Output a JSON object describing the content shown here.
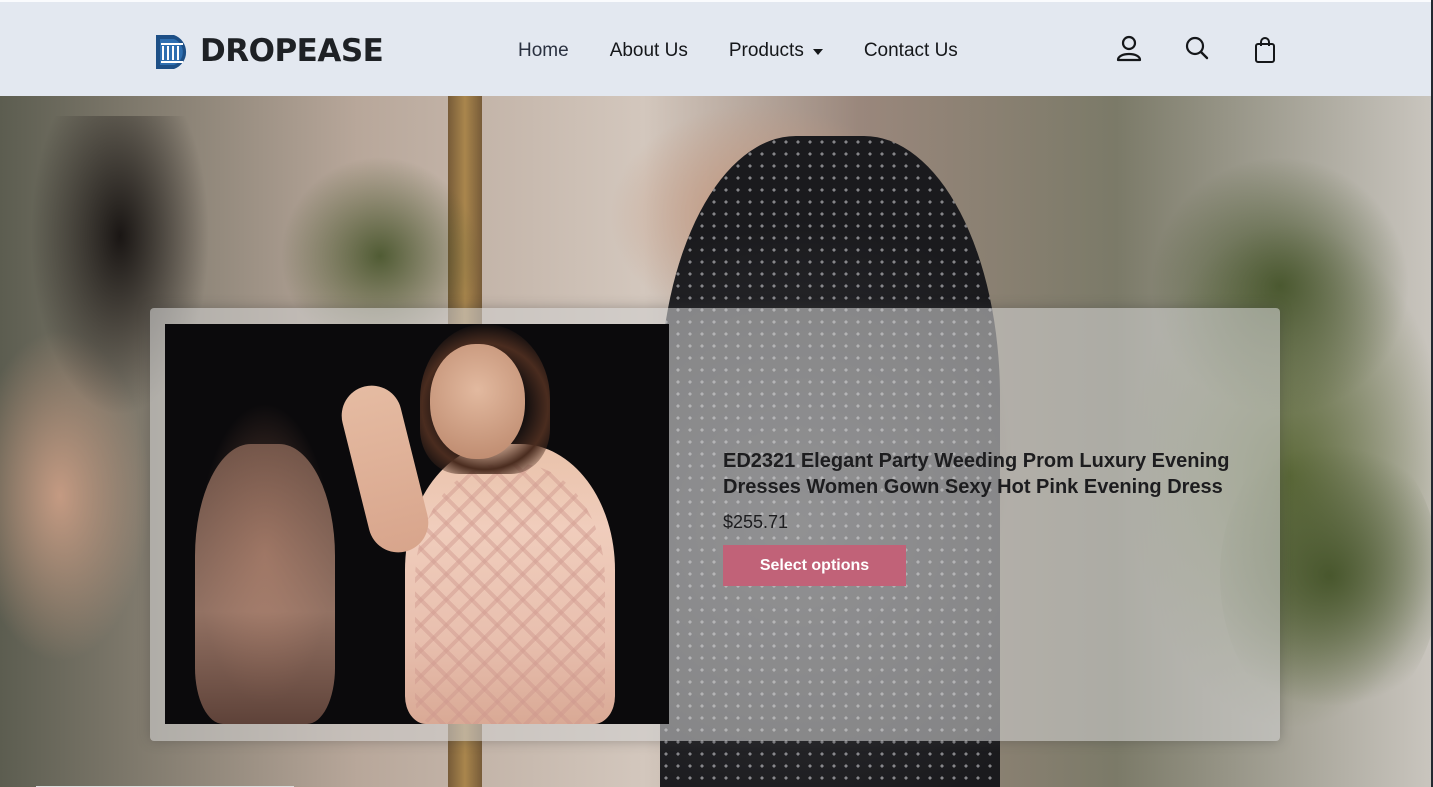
{
  "brand": {
    "name": "DROPEASE",
    "logo_icon": "bank-building-icon",
    "accent": "#1d4f86"
  },
  "nav": [
    {
      "label": "Home",
      "active": true
    },
    {
      "label": "About Us"
    },
    {
      "label": "Products",
      "has_dropdown": true
    },
    {
      "label": "Contact Us"
    }
  ],
  "header_icons": [
    "user-icon",
    "search-icon",
    "shopping-bag-icon"
  ],
  "product": {
    "title": "ED2321 Elegant Party Weeding Prom Luxury Evening Dresses Women Gown Sexy Hot Pink Evening Dress",
    "price": "$255.71",
    "button_label": "Select options",
    "button_color": "#c16278"
  }
}
